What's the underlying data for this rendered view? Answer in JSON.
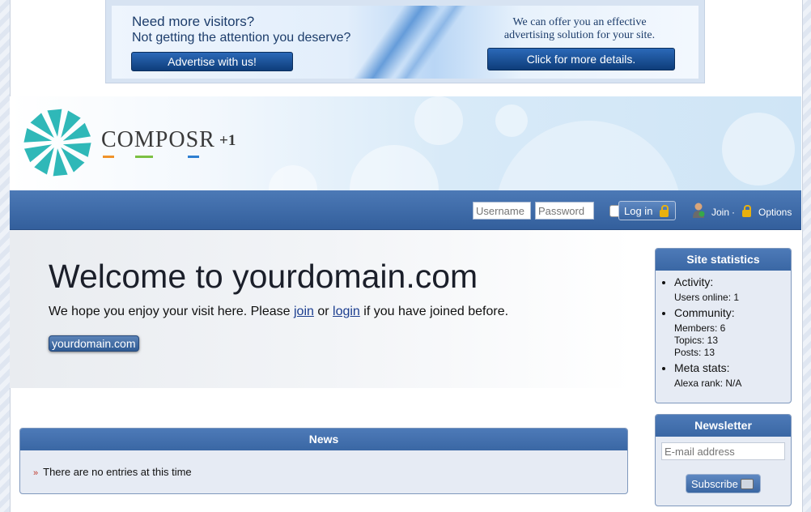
{
  "ad": {
    "headline": "Need more visitors?",
    "subline": "Not getting the attention you deserve?",
    "left_button": "Advertise with us!",
    "right_text": "We can offer you an effective advertising solution for your site.",
    "right_button": "Click for more details."
  },
  "logo": {
    "name": "COMPOSR",
    "suffix": "+1"
  },
  "login": {
    "username_placeholder": "Username",
    "password_placeholder": "Password",
    "login_label": "Log in",
    "join_label": "Join",
    "separator": "·",
    "options_label": "Options"
  },
  "welcome": {
    "title": "Welcome to yourdomain.com",
    "text_before": "We hope you enjoy your visit here. Please ",
    "join_link": "join",
    "text_middle": " or ",
    "login_link": "login",
    "text_after": " if you have joined before.",
    "badge": "yourdomain.com"
  },
  "news": {
    "title": "News",
    "empty_text": "There are no entries at this time"
  },
  "site_statistics": {
    "title": "Site statistics",
    "activity_label": "Activity:",
    "users_online": "Users online:  1",
    "community_label": "Community:",
    "members": "Members:  6",
    "topics": "Topics:  13",
    "posts": "Posts:  13",
    "meta_label": "Meta stats:",
    "alexa": "Alexa rank:  N/A"
  },
  "newsletter": {
    "title": "Newsletter",
    "email_placeholder": "E-mail address",
    "subscribe_label": "Subscribe"
  },
  "colors": {
    "brand_blue": "#3a67a4",
    "logo_teal": "#2fb8b8"
  }
}
